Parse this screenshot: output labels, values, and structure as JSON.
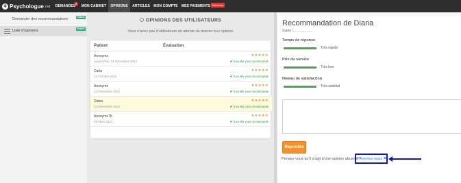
{
  "nav": {
    "logo": "Psychologue",
    "logo_suffix": ".net",
    "items": [
      {
        "label": "DEMANDES",
        "badge": "4"
      },
      {
        "label": "MON CABINET"
      },
      {
        "label": "OPINIONS"
      },
      {
        "label": "ARTICLES"
      },
      {
        "label": "MON COMPTE"
      },
      {
        "label": "MES PAIEMENTS",
        "badge": "Nouveau"
      }
    ],
    "active": "OPINIONS"
  },
  "sidebar": {
    "items": [
      {
        "label": "Demander des recommandations",
        "badge": "Gratuit"
      },
      {
        "label": "Liste d'opinions",
        "badge": "Gratuit"
      }
    ]
  },
  "main": {
    "title": "OPINIONS DES UTILISATEURS",
    "waiting_text": "Vous n'avez pas d'utilisateurs en attente de donner leur opinion",
    "columns": [
      "Patient",
      "Évaluation"
    ],
    "reviews": [
      {
        "name": "Anonyme",
        "date": "Aujourd'hui, 01 Décembre 2022",
        "stars": "★★★★★",
        "rating": 5,
        "recommend": "Il ou elle vous recommande"
      },
      {
        "name": "Carla",
        "date": "13 Octobre 2022",
        "stars": "★★★★★",
        "rating": 5,
        "recommend": "Il ou elle vous recommande"
      },
      {
        "name": "Anonyme",
        "date": "22 Décembre 2021",
        "stars": "★★★★★",
        "rating": 5,
        "recommend": "Il ou elle vous recommande"
      },
      {
        "name": "Diana",
        "date": "02 Décembre 2021",
        "stars": "★★★★★",
        "rating": 5,
        "recommend": "Il ou elle vous recommande"
      },
      {
        "name": "Anonyme78",
        "date": "29 Mars 2021",
        "stars": "★★★★★",
        "rating": 5,
        "recommend": "Il ou elle vous recommande"
      }
    ],
    "highlighted_row": 3
  },
  "detail": {
    "title": "Recommandation de Diana",
    "subtitle": "Super !....................",
    "criteria": [
      {
        "label": "Temps de réponse",
        "value": "Très rapide",
        "level": 1.0
      },
      {
        "label": "Prix du service",
        "value": "Très bon",
        "level": 1.0
      },
      {
        "label": "Niveau de satisfaction",
        "value": "Très satisfait",
        "level": 1.0
      }
    ],
    "reply_label": "Répondre",
    "abuse_text": "Pensez-vous qu'il s'agit d'une opinion abusive ?",
    "abuse_link": "Prévenez-nous ⚑",
    "highlight_color": "#1414c8",
    "accent_color": "#f5902b",
    "bar_color": "#49a849"
  }
}
